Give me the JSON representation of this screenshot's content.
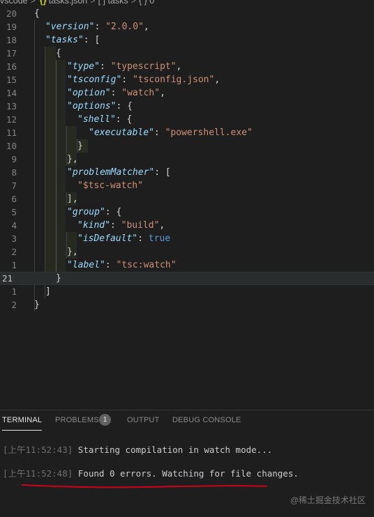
{
  "breadcrumb": {
    "folder": "vscode",
    "json_icon": "{}",
    "file": "tasks.json",
    "array_icon": "[ ]",
    "node": "tasks",
    "object_icon": "{ }",
    "index": "0",
    "separator": ">"
  },
  "editor": {
    "line_numbers": [
      "20",
      "19",
      "18",
      "17",
      "16",
      "15",
      "14",
      "13",
      "12",
      "11",
      "10",
      "9",
      "8",
      "7",
      "6",
      "5",
      "4",
      "3",
      "2",
      "1",
      "21",
      "1",
      "2"
    ],
    "current_line_number": "21",
    "lines": {
      "l0_open": "{",
      "version_key": "\"version\"",
      "version_val": "\"2.0.0\"",
      "tasks_key": "\"tasks\"",
      "tasks_open": "[",
      "obj_open": "{",
      "type_key": "\"type\"",
      "type_val": "\"typescript\"",
      "tsconfig_key": "\"tsconfig\"",
      "tsconfig_val": "\"tsconfig.json\"",
      "option_key": "\"option\"",
      "option_val": "\"watch\"",
      "options_key": "\"options\"",
      "shell_key": "\"shell\"",
      "executable_key": "\"executable\"",
      "executable_val": "\"powershell.exe\"",
      "problemMatcher_key": "\"problemMatcher\"",
      "problemMatcher_val": "\"$tsc-watch\"",
      "group_key": "\"group\"",
      "kind_key": "\"kind\"",
      "kind_val": "\"build\"",
      "isDefault_key": "\"isDefault\"",
      "isDefault_val": "true",
      "label_key": "\"label\"",
      "label_val": "\"tsc:watch\""
    }
  },
  "panel": {
    "tabs": [
      {
        "label": "TERMINAL",
        "active": true
      },
      {
        "label": "PROBLEMS",
        "active": false
      },
      {
        "label": "OUTPUT",
        "active": false
      },
      {
        "label": "DEBUG CONSOLE",
        "active": false
      }
    ],
    "problems_count": "1",
    "terminal_lines": [
      {
        "timestamp": "[上午11:52:43]",
        "message": " Starting compilation in watch mode..."
      },
      {
        "timestamp": "[上午11:52:48]",
        "message": " Found 0 errors. Watching for file changes."
      }
    ]
  },
  "watermark": "@稀土掘金技术社区",
  "colors": {
    "background": "#1e1e1e",
    "key": "#9cdcfe",
    "string": "#ce9178",
    "keyword": "#569cd6",
    "annotation_underline": "#d0021b"
  }
}
